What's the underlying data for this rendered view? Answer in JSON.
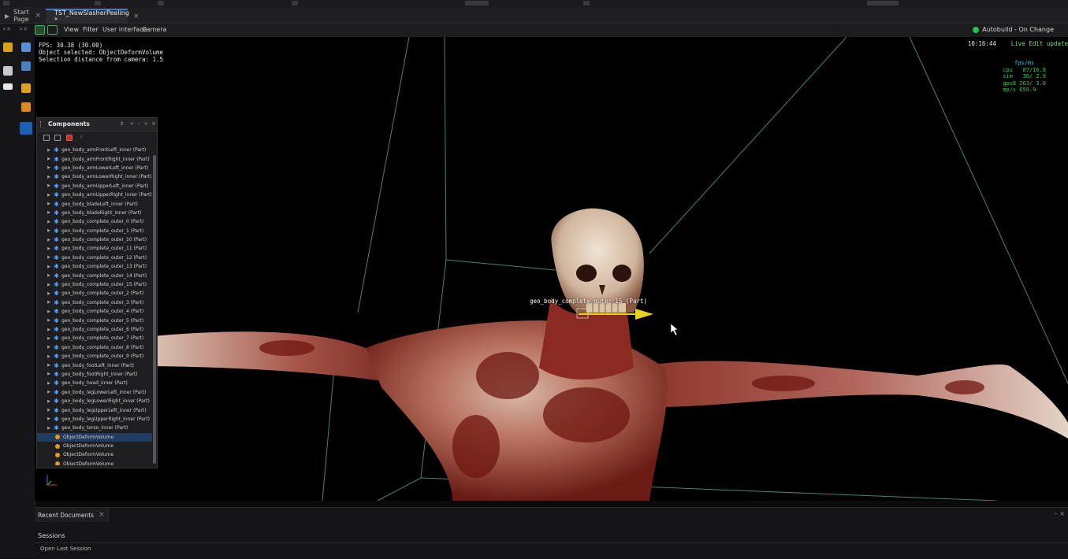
{
  "tabs": [
    {
      "label": "Start Page",
      "active": false
    },
    {
      "label": "TST_NewSlasherPeeling *",
      "active": true
    }
  ],
  "viewport_toolbar": {
    "menus": [
      "View",
      "Filter",
      "User interface",
      "Camera"
    ],
    "autobuild": "Autobuild - On Change"
  },
  "overlay": {
    "fps": "FPS: 30.38 (30.00)",
    "object_selected": "Object selected: ObjectDeformVolume",
    "selection_distance": "Selection distance from camera: 1.5",
    "clock": "10:16:44",
    "live_edit": "Live Edit update",
    "perf_header": "fps/ms",
    "perf": [
      "cpu   87/16.8",
      "sim   30/ 2.9",
      "gpu8 263/ 3.0",
      "mp/s 659.9"
    ],
    "gizmo_label": "geo_body_complete_outer_15 (Part)"
  },
  "components": {
    "title": "Components",
    "items": [
      {
        "label": "geo_body_armFrontLeft_inner (Part)",
        "type": "part"
      },
      {
        "label": "geo_body_armFrontRight_inner (Part)",
        "type": "part"
      },
      {
        "label": "geo_body_armLowerLeft_inner (Part)",
        "type": "part"
      },
      {
        "label": "geo_body_armLowerRight_inner (Part)",
        "type": "part"
      },
      {
        "label": "geo_body_armUpperLeft_inner (Part)",
        "type": "part"
      },
      {
        "label": "geo_body_armUpperRight_inner (Part)",
        "type": "part"
      },
      {
        "label": "geo_body_bladeLeft_inner (Part)",
        "type": "part"
      },
      {
        "label": "geo_body_bladeRight_inner (Part)",
        "type": "part"
      },
      {
        "label": "geo_body_complete_outer_0 (Part)",
        "type": "part"
      },
      {
        "label": "geo_body_complete_outer_1 (Part)",
        "type": "part"
      },
      {
        "label": "geo_body_complete_outer_10 (Part)",
        "type": "part"
      },
      {
        "label": "geo_body_complete_outer_11 (Part)",
        "type": "part"
      },
      {
        "label": "geo_body_complete_outer_12 (Part)",
        "type": "part"
      },
      {
        "label": "geo_body_complete_outer_13 (Part)",
        "type": "part"
      },
      {
        "label": "geo_body_complete_outer_14 (Part)",
        "type": "part"
      },
      {
        "label": "geo_body_complete_outer_15 (Part)",
        "type": "part"
      },
      {
        "label": "geo_body_complete_outer_2 (Part)",
        "type": "part"
      },
      {
        "label": "geo_body_complete_outer_3 (Part)",
        "type": "part"
      },
      {
        "label": "geo_body_complete_outer_4 (Part)",
        "type": "part"
      },
      {
        "label": "geo_body_complete_outer_5 (Part)",
        "type": "part"
      },
      {
        "label": "geo_body_complete_outer_6 (Part)",
        "type": "part"
      },
      {
        "label": "geo_body_complete_outer_7 (Part)",
        "type": "part"
      },
      {
        "label": "geo_body_complete_outer_8 (Part)",
        "type": "part"
      },
      {
        "label": "geo_body_complete_outer_9 (Part)",
        "type": "part"
      },
      {
        "label": "geo_body_footLeft_inner (Part)",
        "type": "part"
      },
      {
        "label": "geo_body_footRight_inner (Part)",
        "type": "part"
      },
      {
        "label": "geo_body_head_inner (Part)",
        "type": "part"
      },
      {
        "label": "geo_body_legLowerLeft_inner (Part)",
        "type": "part"
      },
      {
        "label": "geo_body_legLowerRight_inner (Part)",
        "type": "part"
      },
      {
        "label": "geo_body_legUpperLeft_inner (Part)",
        "type": "part"
      },
      {
        "label": "geo_body_legUpperRight_inner (Part)",
        "type": "part"
      },
      {
        "label": "geo_body_torso_inner (Part)",
        "type": "part"
      },
      {
        "label": "ObjectDeformVolume",
        "type": "object",
        "selected": true
      },
      {
        "label": "ObjectDeformVolume",
        "type": "object"
      },
      {
        "label": "ObjectDeformVolume",
        "type": "object"
      },
      {
        "label": "ObjectDeformVolume",
        "type": "object"
      }
    ]
  },
  "bottom_panel": {
    "tab": "Recent Documents",
    "sessions": "Sessions",
    "open_last": "Open Last Session"
  },
  "colors": {
    "accent": "#3a7bd5",
    "selection": "#1f3b5f",
    "perf_green": "#28d24a",
    "gizmo_yellow": "#e6d21a"
  }
}
